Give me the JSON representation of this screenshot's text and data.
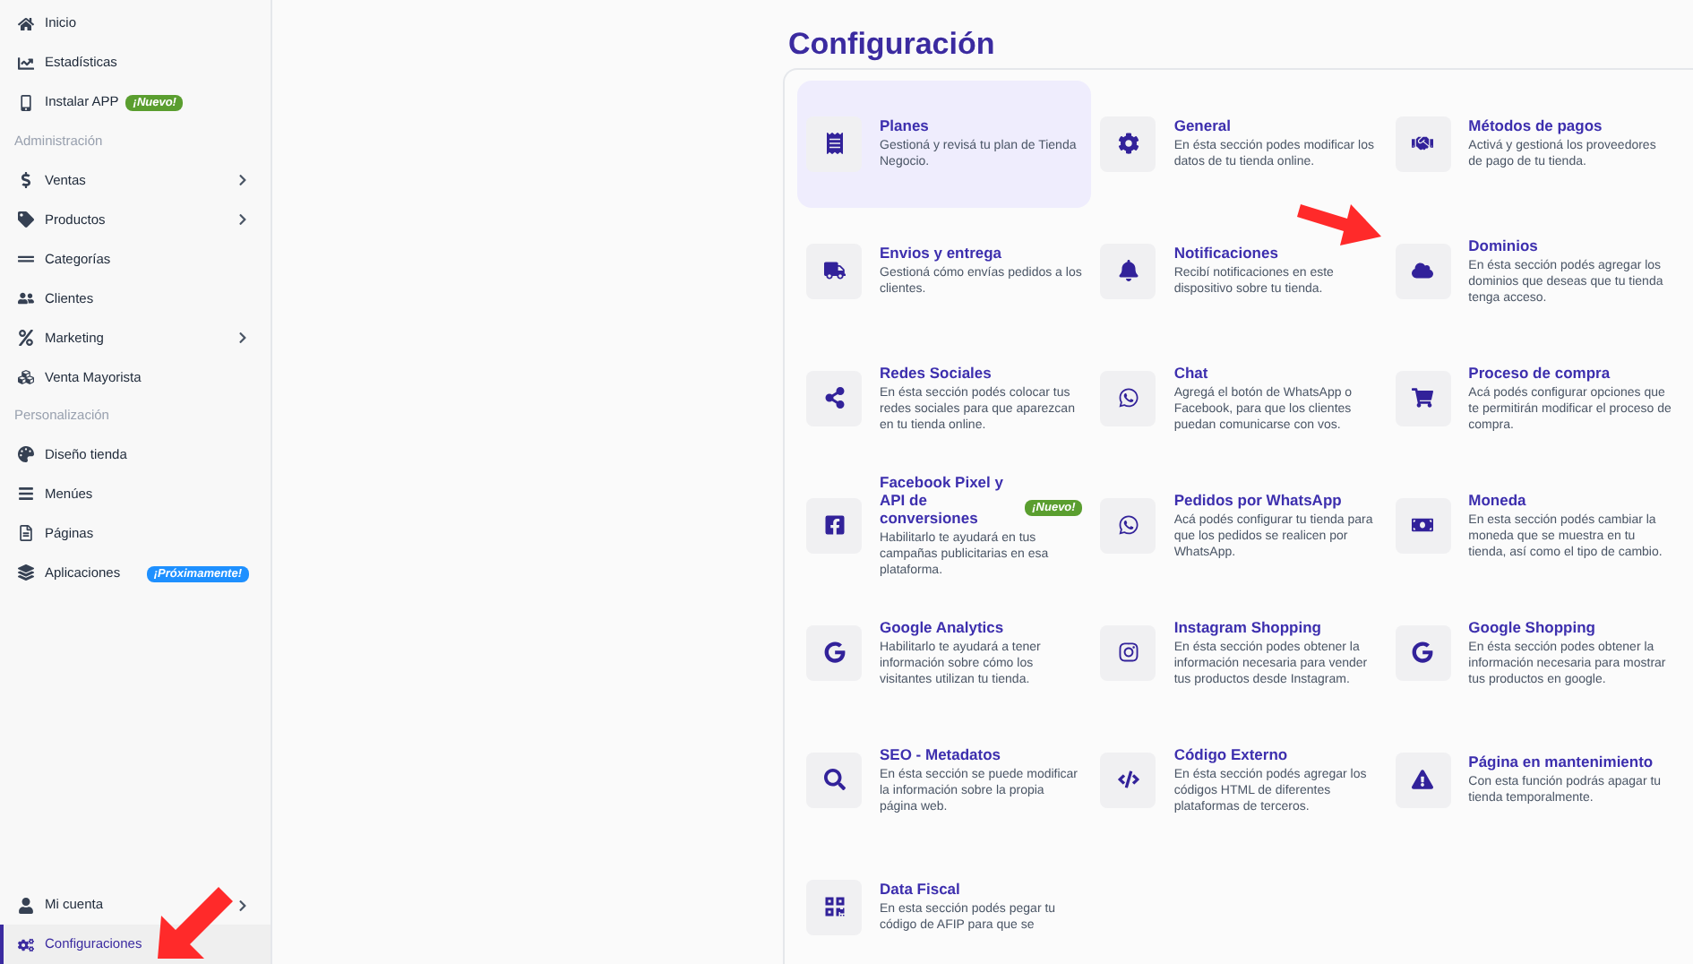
{
  "sidebar": {
    "items": [
      {
        "kind": "item",
        "label": "Inicio",
        "expandable": false,
        "selected": false
      },
      {
        "kind": "item",
        "label": "Estadísticas",
        "expandable": false,
        "selected": false
      },
      {
        "kind": "item",
        "label": "Instalar APP",
        "badge": {
          "text": "¡Nuevo!",
          "color": "#5a9e2f"
        },
        "expandable": false,
        "selected": false
      },
      {
        "kind": "section",
        "label": "Administración"
      },
      {
        "kind": "item",
        "label": "Ventas",
        "expandable": true,
        "selected": false
      },
      {
        "kind": "item",
        "label": "Productos",
        "expandable": true,
        "selected": false
      },
      {
        "kind": "item",
        "label": "Categorías",
        "expandable": false,
        "selected": false
      },
      {
        "kind": "item",
        "label": "Clientes",
        "expandable": false,
        "selected": false
      },
      {
        "kind": "item",
        "label": "Marketing",
        "expandable": true,
        "selected": false
      },
      {
        "kind": "item",
        "label": "Venta Mayorista",
        "expandable": false,
        "selected": false
      },
      {
        "kind": "section",
        "label": "Personalización"
      },
      {
        "kind": "item",
        "label": "Diseño tienda",
        "expandable": false,
        "selected": false
      },
      {
        "kind": "item",
        "label": "Menúes",
        "expandable": false,
        "selected": false
      },
      {
        "kind": "item",
        "label": "Páginas",
        "expandable": false,
        "selected": false
      },
      {
        "kind": "item",
        "label": "Aplicaciones",
        "badge": {
          "text": "¡Próximamente!",
          "color": "#1e90ff"
        },
        "expandable": false,
        "selected": false
      }
    ],
    "bottom_items": [
      {
        "kind": "item",
        "label": "Mi cuenta",
        "expandable": true,
        "selected": false
      },
      {
        "kind": "item",
        "label": "Configuraciones",
        "expandable": false,
        "selected": true
      }
    ]
  },
  "page_title": "Configuración",
  "settings": [
    {
      "title": "Planes",
      "description": "Gestioná y revisá tu plan de Tienda Negocio.",
      "selected": true
    },
    {
      "title": "General",
      "description": "En ésta sección podes modificar los datos de tu tienda online.",
      "selected": false
    },
    {
      "title": "Métodos de pagos",
      "description": "Activá y gestioná los proveedores de pago de tu tienda.",
      "selected": false
    },
    {
      "title": "Envios y entrega",
      "description": "Gestioná cómo envías pedidos a los clientes.",
      "selected": false
    },
    {
      "title": "Notificaciones",
      "description": "Recibí notificaciones en este dispositivo sobre tu tienda.",
      "selected": false
    },
    {
      "title": "Dominios",
      "description": "En ésta sección podés agregar los dominios que deseas que tu tienda tenga acceso.",
      "selected": false
    },
    {
      "title": "Redes Sociales",
      "description": "En ésta sección podés colocar tus redes sociales para que aparezcan en tu tienda online.",
      "selected": false
    },
    {
      "title": "Chat",
      "description": "Agregá el botón de WhatsApp o Facebook, para que los clientes puedan comunicarse con vos.",
      "selected": false
    },
    {
      "title": "Proceso de compra",
      "description": "Acá podés configurar opciones que te permitirán modificar el proceso de compra.",
      "selected": false
    },
    {
      "title": "Facebook Pixel y API de conversiones",
      "badge": {
        "text": "¡Nuevo!",
        "color": "#5a9e2f"
      },
      "description": "Habilitarlo te ayudará en tus campañas publicitarias en esa plataforma.",
      "selected": false
    },
    {
      "title": "Pedidos por WhatsApp",
      "description": "Acá podés configurar tu tienda para que los pedidos se realicen por WhatsApp.",
      "selected": false
    },
    {
      "title": "Moneda",
      "description": "En esta sección podés cambiar la moneda que se muestra en tu tienda, así como el tipo de cambio.",
      "selected": false
    },
    {
      "title": "Google Analytics",
      "description": "Habilitarlo te ayudará a tener información sobre cómo los visitantes utilizan tu tienda.",
      "selected": false
    },
    {
      "title": "Instagram Shopping",
      "description": "En ésta sección podes obtener la información necesaria para vender tus productos desde Instagram.",
      "selected": false
    },
    {
      "title": "Google Shopping",
      "description": "En ésta sección podes obtener la información necesaria para mostrar tus productos en google.",
      "selected": false
    },
    {
      "title": "SEO - Metadatos",
      "description": "En ésta sección se puede modificar la información sobre la propia página web.",
      "selected": false
    },
    {
      "title": "Código Externo",
      "description": "En ésta sección podés agregar los códigos HTML de diferentes plataformas de terceros.",
      "selected": false
    },
    {
      "title": "Página en mantenimiento",
      "description": "Con esta función podrás apagar tu tienda temporalmente.",
      "selected": false
    },
    {
      "title": "Data Fiscal",
      "description": "En esta sección podés pegar tu código de AFIP para que se",
      "selected": false
    }
  ]
}
